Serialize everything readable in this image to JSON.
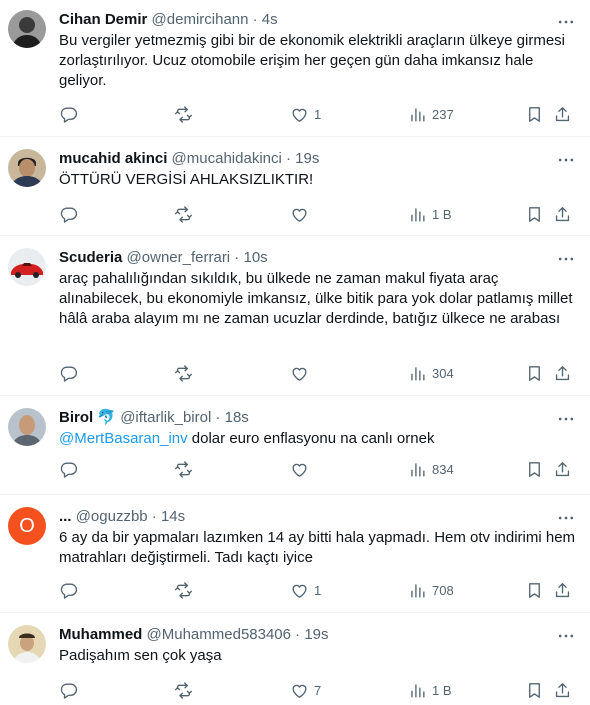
{
  "tweets": [
    {
      "name": "Cihan Demir",
      "meta": "@demircihann · 4s",
      "text": "Bu vergiler yetmezmiş gibi bir de ekonomik elektrikli araçların ülkeye girmesi zorlaştırılıyor. Ucuz otomobile erişim her geçen gün daha imkansız hale geliyor.",
      "replies": "",
      "retweets": "",
      "likes": "1",
      "views": "237"
    },
    {
      "name": "mucahid akinci",
      "meta": "@mucahidakinci · 19s",
      "text": "ÖTTÜRÜ VERGİSİ AHLAKSIZLIKTIR!",
      "replies": "",
      "retweets": "",
      "likes": "",
      "views": "1 B"
    },
    {
      "name": "Scuderia",
      "meta": "@owner_ferrari · 10s",
      "text": "araç pahalılığından sıkıldık, bu ülkede ne zaman makul fiyata araç alınabilecek, bu ekonomiyle imkansız, ülke bitik para yok dolar patlamış millet hâlâ araba alayım mı ne zaman ucuzlar derdinde, batığız ülkece ne arabası",
      "replies": "",
      "retweets": "",
      "likes": "",
      "views": "304"
    },
    {
      "name": "Birol",
      "name_emoji": "🐬",
      "meta": "@iftarlik_birol · 18s",
      "mention": "@MertBasaran_inv",
      "text": " dolar euro enflasyonu na canlı ornek",
      "replies": "",
      "retweets": "",
      "likes": "",
      "views": "834"
    },
    {
      "name": "...",
      "meta": "@oguzzbb · 14s",
      "avatar_letter": "O",
      "text": "6 ay da bir yapmaları lazımken 14 ay bitti hala yapmadı. Hem otv indirimi hem matrahları değiştirmeli. Tadı kaçtı iyice",
      "replies": "",
      "retweets": "",
      "likes": "1",
      "views": "708"
    },
    {
      "name": "Muhammed",
      "meta": "@Muhammed583406 · 19s",
      "text": "Padişahım sen çok yaşa",
      "replies": "",
      "retweets": "",
      "likes": "7",
      "views": "1 B"
    }
  ],
  "colors": {
    "text": "#0f1419",
    "muted": "#536471",
    "link": "#1d9bf0",
    "divider": "#eff3f4",
    "orange_avatar": "#f4511e"
  },
  "icons": [
    "more-icon",
    "reply-icon",
    "retweet-icon",
    "like-icon",
    "views-icon",
    "bookmark-icon",
    "share-icon"
  ]
}
